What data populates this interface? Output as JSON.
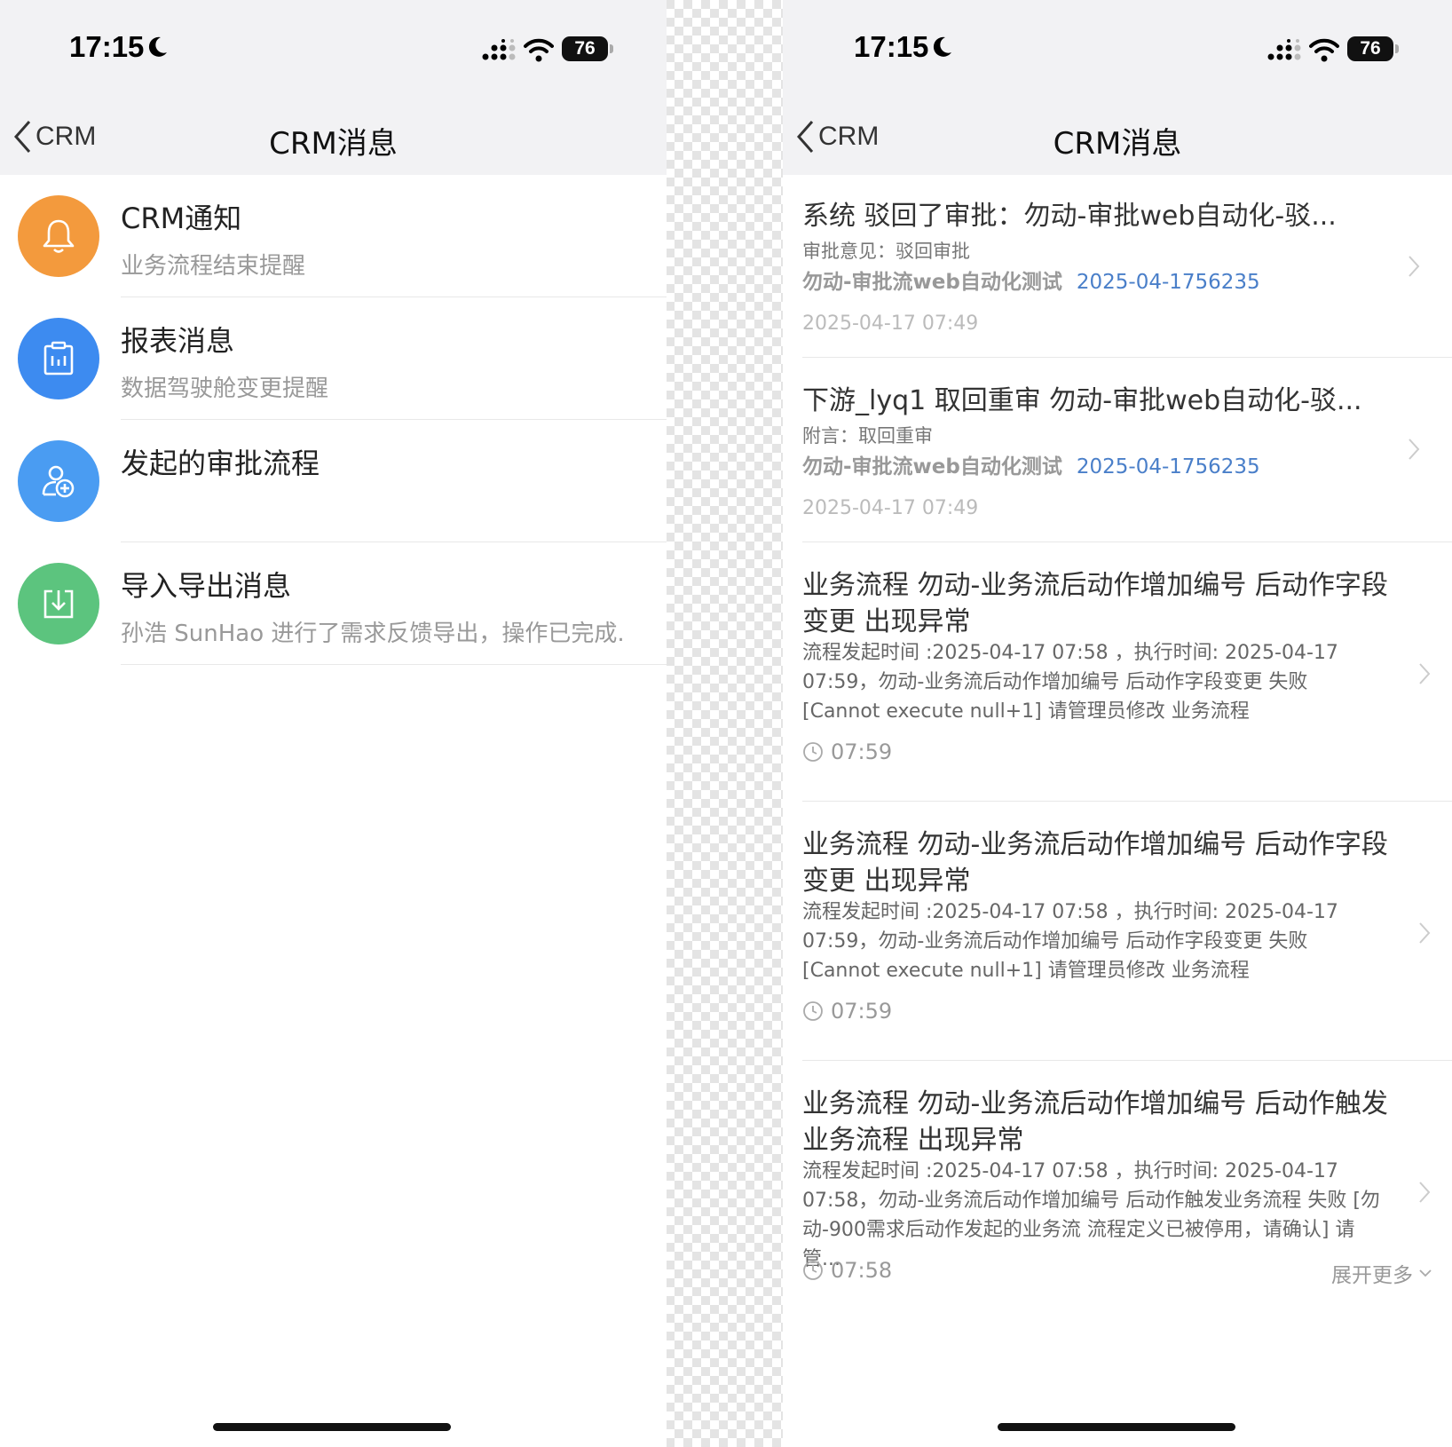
{
  "left": {
    "status": {
      "time": "17:15",
      "battery": "76"
    },
    "nav": {
      "back": "CRM",
      "title": "CRM消息"
    },
    "items": [
      {
        "title": "CRM通知",
        "subtitle": "业务流程结束提醒",
        "icon": "bell-icon",
        "color": "#f39a3d"
      },
      {
        "title": "报表消息",
        "subtitle": "数据驾驶舱变更提醒",
        "icon": "report-icon",
        "color": "#3d8bf0"
      },
      {
        "title": "发起的审批流程",
        "subtitle": "",
        "icon": "user-add-icon",
        "color": "#4a9cf2"
      },
      {
        "title": "导入导出消息",
        "subtitle": "孙浩 SunHao 进行了需求反馈导出，操作已完成.",
        "icon": "import-export-icon",
        "color": "#5cc47e"
      }
    ]
  },
  "right": {
    "status": {
      "time": "17:15",
      "battery": "76"
    },
    "nav": {
      "back": "CRM",
      "title": "CRM消息"
    },
    "approvals": [
      {
        "title": "系统 驳回了审批：勿动-审批web自动化-驳...",
        "note": "审批意见：驳回审批",
        "flow": "勿动-审批流web自动化测试",
        "code": "2025-04-1756235",
        "time": "2025-04-17 07:49"
      },
      {
        "title": "下游_lyq1 取回重审 勿动-审批web自动化-驳...",
        "note": "附言：取回重审",
        "flow": "勿动-审批流web自动化测试",
        "code": "2025-04-1756235",
        "time": "2025-04-17 07:49"
      }
    ],
    "workflows": [
      {
        "title": "业务流程 勿动-业务流后动作增加编号 后动作字段变更 出现异常",
        "body": "流程发起时间 :2025-04-17 07:58 ，执行时间: 2025-04-17 07:59，勿动-业务流后动作增加编号  后动作字段变更  失败 [Cannot execute null+1] 请管理员修改  业务流程",
        "time": "07:59"
      },
      {
        "title": "业务流程 勿动-业务流后动作增加编号 后动作字段变更 出现异常",
        "body": "流程发起时间 :2025-04-17 07:58 ，执行时间: 2025-04-17 07:59，勿动-业务流后动作增加编号  后动作字段变更  失败 [Cannot execute null+1] 请管理员修改  业务流程",
        "time": "07:59"
      },
      {
        "title": "业务流程 勿动-业务流后动作增加编号 后动作触发业务流程 出现异常",
        "body": "流程发起时间 :2025-04-17 07:58 ，执行时间: 2025-04-17 07:58，勿动-业务流后动作增加编号  后动作触发业务流程  失败 [勿动-900需求后动作发起的业务流 流程定义已被停用，请确认] 请管...",
        "time": "07:58",
        "expand": "展开更多"
      }
    ]
  }
}
